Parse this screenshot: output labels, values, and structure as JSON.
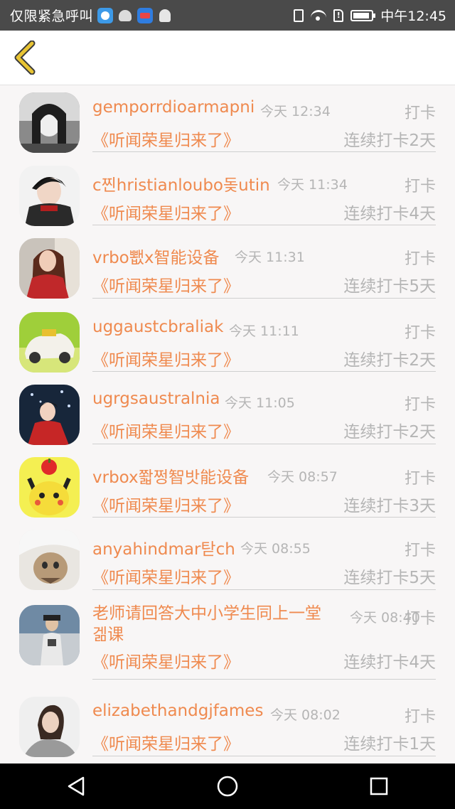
{
  "status_bar": {
    "carrier_text": "仅限紧急呼叫",
    "time": "中午12:45",
    "notification_icons": [
      "app-notification-icon",
      "qq-icon",
      "app-notification-icon",
      "qq-icon"
    ],
    "status_icons": [
      "vibrate-icon",
      "wifi-icon",
      "sim-alert-icon",
      "battery-icon"
    ]
  },
  "header": {
    "back_icon": "chevron-left-icon"
  },
  "colors": {
    "accent": "#ef8a4f",
    "muted": "#b5b5b5",
    "back_icon": "#e8c433",
    "status_bar": "#4a4a4a"
  },
  "entries": [
    {
      "name": "gemporrdioarmapni",
      "time": "今天 12:34",
      "action": "打卡",
      "topic": "《听闻荣星归来了》",
      "streak": "连续打卡2天"
    },
    {
      "name": "c찐hristianloubo돚utin",
      "time": "今天 11:34",
      "action": "打卡",
      "topic": "《听闻荣星归来了》",
      "streak": "连续打卡4天"
    },
    {
      "name": "vrbo뾊x智能设备",
      "time": "今天 11:31",
      "action": "打卡",
      "topic": "《听闻荣星归来了》",
      "streak": "连续打卡5天"
    },
    {
      "name": "uggaustcbraliak",
      "time": "今天 11:11",
      "action": "打卡",
      "topic": "《听闻荣星归来了》",
      "streak": "连续打卡2天"
    },
    {
      "name": "ugrgsaustralnia",
      "time": "今天 11:05",
      "action": "打卡",
      "topic": "《听闻荣星归来了》",
      "streak": "连续打卡2天"
    },
    {
      "name": "vrbox쫣쩡智밧能设备",
      "time": "今天 08:57",
      "action": "打卡",
      "topic": "《听闻荣星归来了》",
      "streak": "连续打卡3天"
    },
    {
      "name": "anyahindmar탇ch",
      "time": "今天 08:55",
      "action": "打卡",
      "topic": "《听闻荣星归来了》",
      "streak": "连续打卡5天"
    },
    {
      "name": "老师请回答大中小学生同上一堂겖课",
      "time": "今天 08:40",
      "action": "打卡",
      "topic": "《听闻荣星归来了》",
      "streak": "连续打卡4天"
    },
    {
      "name": "elizabethandgjfames",
      "time": "今天 08:02",
      "action": "打卡",
      "topic": "《听闻荣星归来了》",
      "streak": "连续打卡1天"
    }
  ],
  "nav_bar": {
    "icons": [
      "back-triangle-icon",
      "home-circle-icon",
      "recents-square-icon"
    ]
  }
}
